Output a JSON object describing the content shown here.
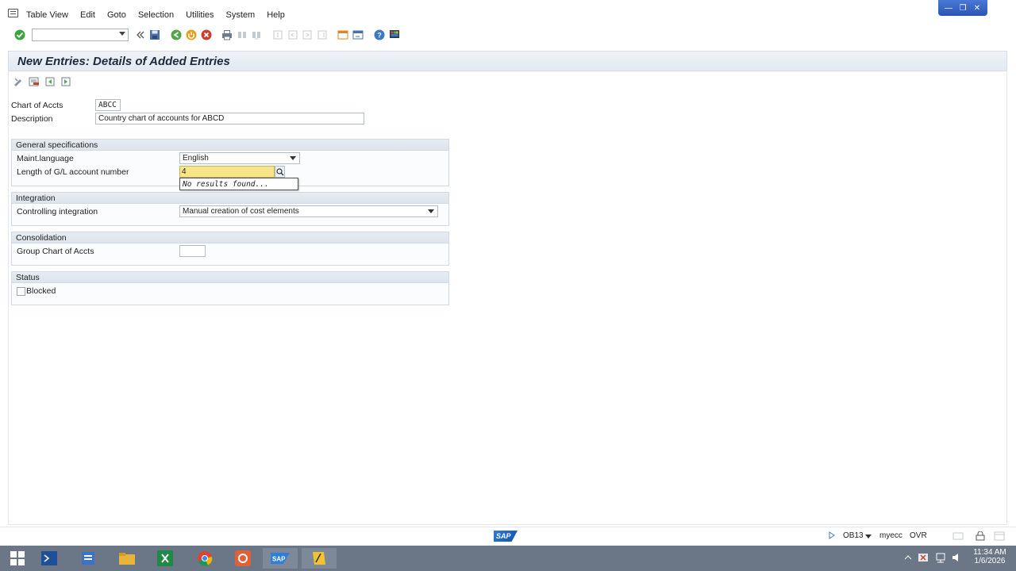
{
  "menu": {
    "items": [
      "Table View",
      "Edit",
      "Goto",
      "Selection",
      "Utilities",
      "System",
      "Help"
    ]
  },
  "window": {
    "controls": [
      "minimize",
      "restore",
      "close"
    ]
  },
  "toolbar": {
    "command_field_value": ""
  },
  "page": {
    "title": "New Entries: Details of Added Entries"
  },
  "header": {
    "chart_label": "Chart of Accts",
    "chart_value": "ABCC",
    "description_label": "Description",
    "description_value": "Country chart of accounts for ABCD"
  },
  "general": {
    "title": "General specifications",
    "maint_language_label": "Maint.language",
    "maint_language_value": "English",
    "gl_length_label": "Length of G/L account number",
    "gl_length_value": "4",
    "suggest_text": "No results found..."
  },
  "integration": {
    "title": "Integration",
    "controlling_label": "Controlling integration",
    "controlling_value": "Manual creation of cost elements"
  },
  "consolidation": {
    "title": "Consolidation",
    "group_chart_label": "Group Chart of Accts",
    "group_chart_value": ""
  },
  "status": {
    "title": "Status",
    "blocked_label": "Blocked",
    "blocked_checked": false
  },
  "statusbar": {
    "logo_text": "SAP",
    "transaction": "OB13",
    "system": "myecc",
    "mode": "OVR"
  },
  "taskbar": {
    "time": "11:34 AM",
    "date": "1/6/2026"
  }
}
